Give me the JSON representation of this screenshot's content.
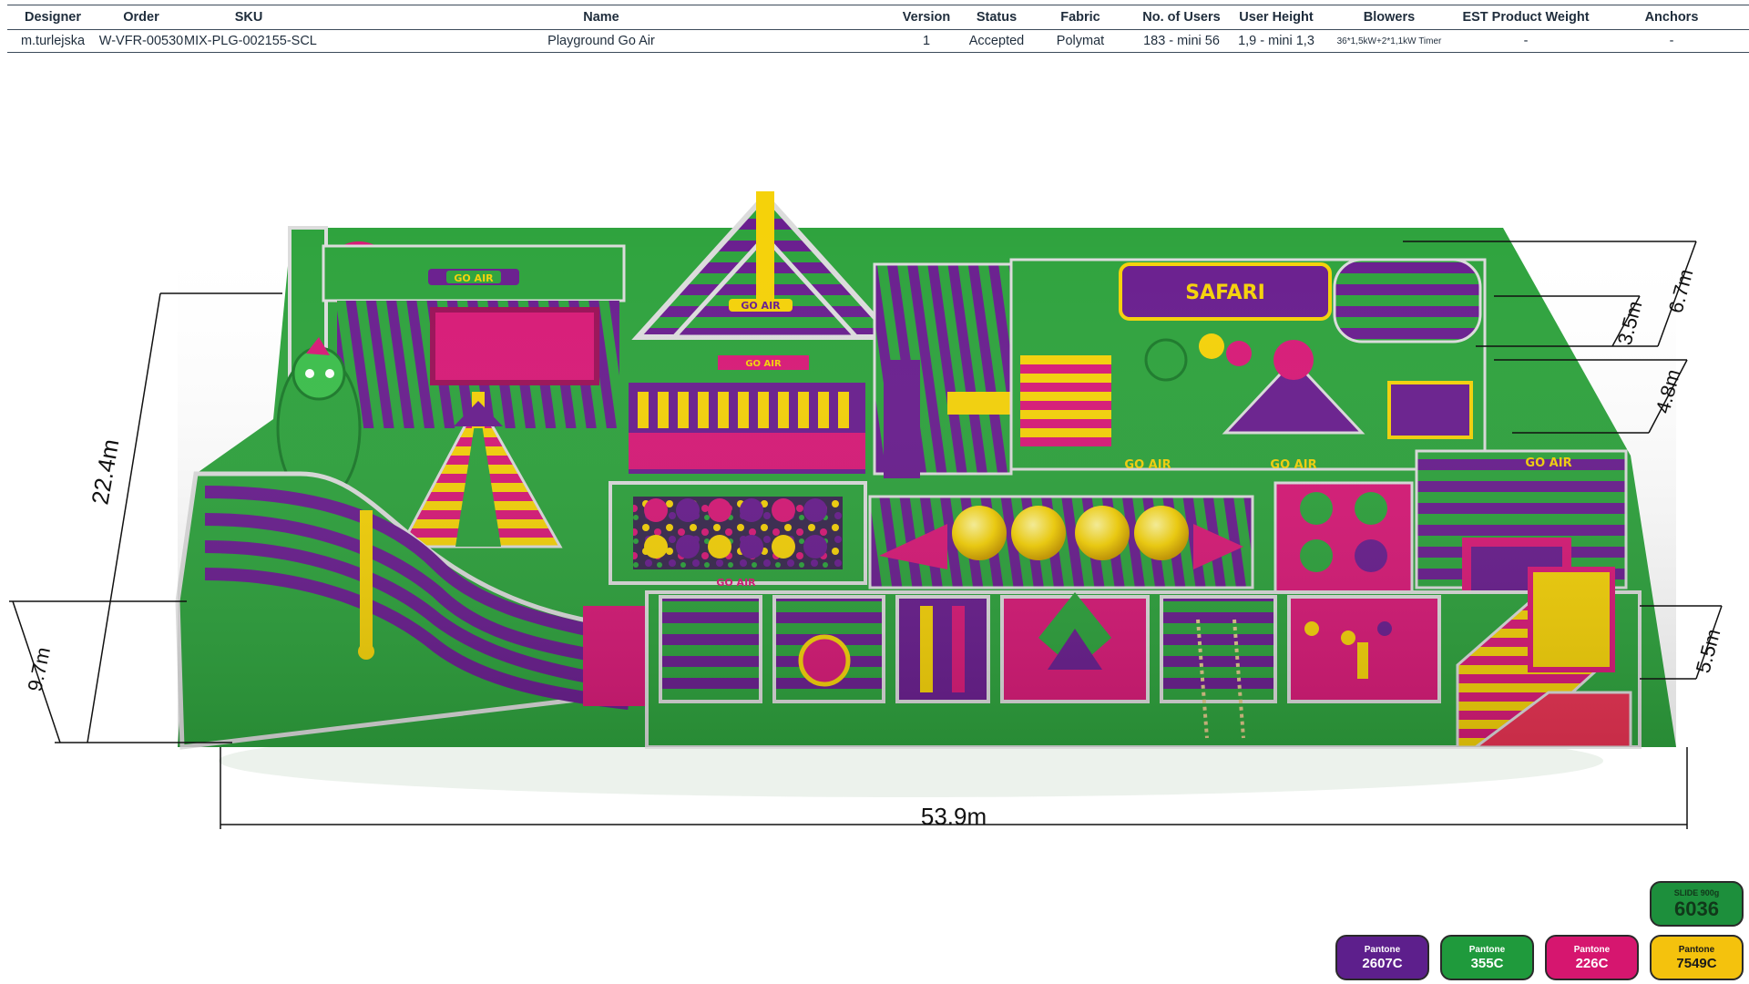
{
  "table": {
    "headers": [
      "Designer",
      "Order",
      "SKU",
      "Name",
      "Version",
      "Status",
      "Fabric",
      "No. of Users",
      "User  Height",
      "Blowers",
      "EST Product Weight",
      "Anchors"
    ],
    "row": [
      "m.turlejska",
      "W-VFR-00530",
      "MIX-PLG-002155-SCL",
      "Playground Go Air",
      "1",
      "Accepted",
      "Polymat",
      "183 - mini 56",
      "1,9 - mini 1,3",
      "36*1,5kW+2*1,1kW Timer",
      "-",
      "-"
    ]
  },
  "dimensions": {
    "length": "53.9m",
    "width": "22.4m",
    "side_height": "9.7m",
    "height_max": "6.7m",
    "height_a": "3.5m",
    "height_b": "4.8m",
    "height_c": "5.5m"
  },
  "signs": {
    "s1": "SAFARI",
    "s2": "GO AIR",
    "s3": "GO AIR",
    "s4": "GO AIR",
    "s5": "GO AIR",
    "s6": "GO AIR",
    "s7": "GO AIR",
    "s8": "GO AIR"
  },
  "swatches": [
    {
      "label": "Pantone",
      "code": "2607C",
      "color": "#5d1f8c"
    },
    {
      "label": "Pantone",
      "code": "355C",
      "color": "#1f9a3c"
    },
    {
      "label": "Pantone",
      "code": "226C",
      "color": "#d6166f"
    },
    {
      "label": "Pantone",
      "code": "7549C",
      "color": "#f4c20d"
    }
  ],
  "slide_swatch": {
    "label": "SLIDE 900g",
    "code": "6036",
    "color": "#1d8f3c"
  },
  "colors": {
    "green": "#2fa33e",
    "dark_green": "#1c7a2b",
    "purple": "#6a1f8f",
    "pink": "#d81b78",
    "yellow": "#f5d20a",
    "white": "#e9e9e9"
  }
}
